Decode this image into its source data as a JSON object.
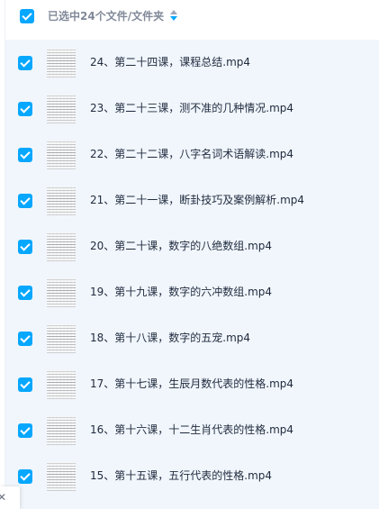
{
  "header": {
    "selection_label": "已选中24个文件/文件夹",
    "select_all_checked": true
  },
  "files": [
    {
      "name": "24、第二十四课，课程总结.mp4",
      "checked": true
    },
    {
      "name": "23、第二十三课，测不准的几种情况.mp4",
      "checked": true
    },
    {
      "name": "22、第二十二课，八字名词术语解读.mp4",
      "checked": true
    },
    {
      "name": "21、第二十一课，断卦技巧及案例解析.mp4",
      "checked": true
    },
    {
      "name": "20、第二十课，数字的八绝数组.mp4",
      "checked": true
    },
    {
      "name": "19、第十九课，数字的六冲数组.mp4",
      "checked": true
    },
    {
      "name": "18、第十八课，数字的五宠.mp4",
      "checked": true
    },
    {
      "name": "17、第十七课，生辰月数代表的性格.mp4",
      "checked": true
    },
    {
      "name": "16、第十六课，十二生肖代表的性格.mp4",
      "checked": true
    },
    {
      "name": "15、第十五课，五行代表的性格.mp4",
      "checked": true
    }
  ],
  "colors": {
    "accent": "#06a7ff",
    "list_background": "#f1f6fd",
    "text": "#1f2a3c",
    "header_text": "#818999"
  },
  "icons": {
    "sort": "sort-icon",
    "close": "close-icon",
    "checkbox": "checkbox-checked-icon"
  }
}
